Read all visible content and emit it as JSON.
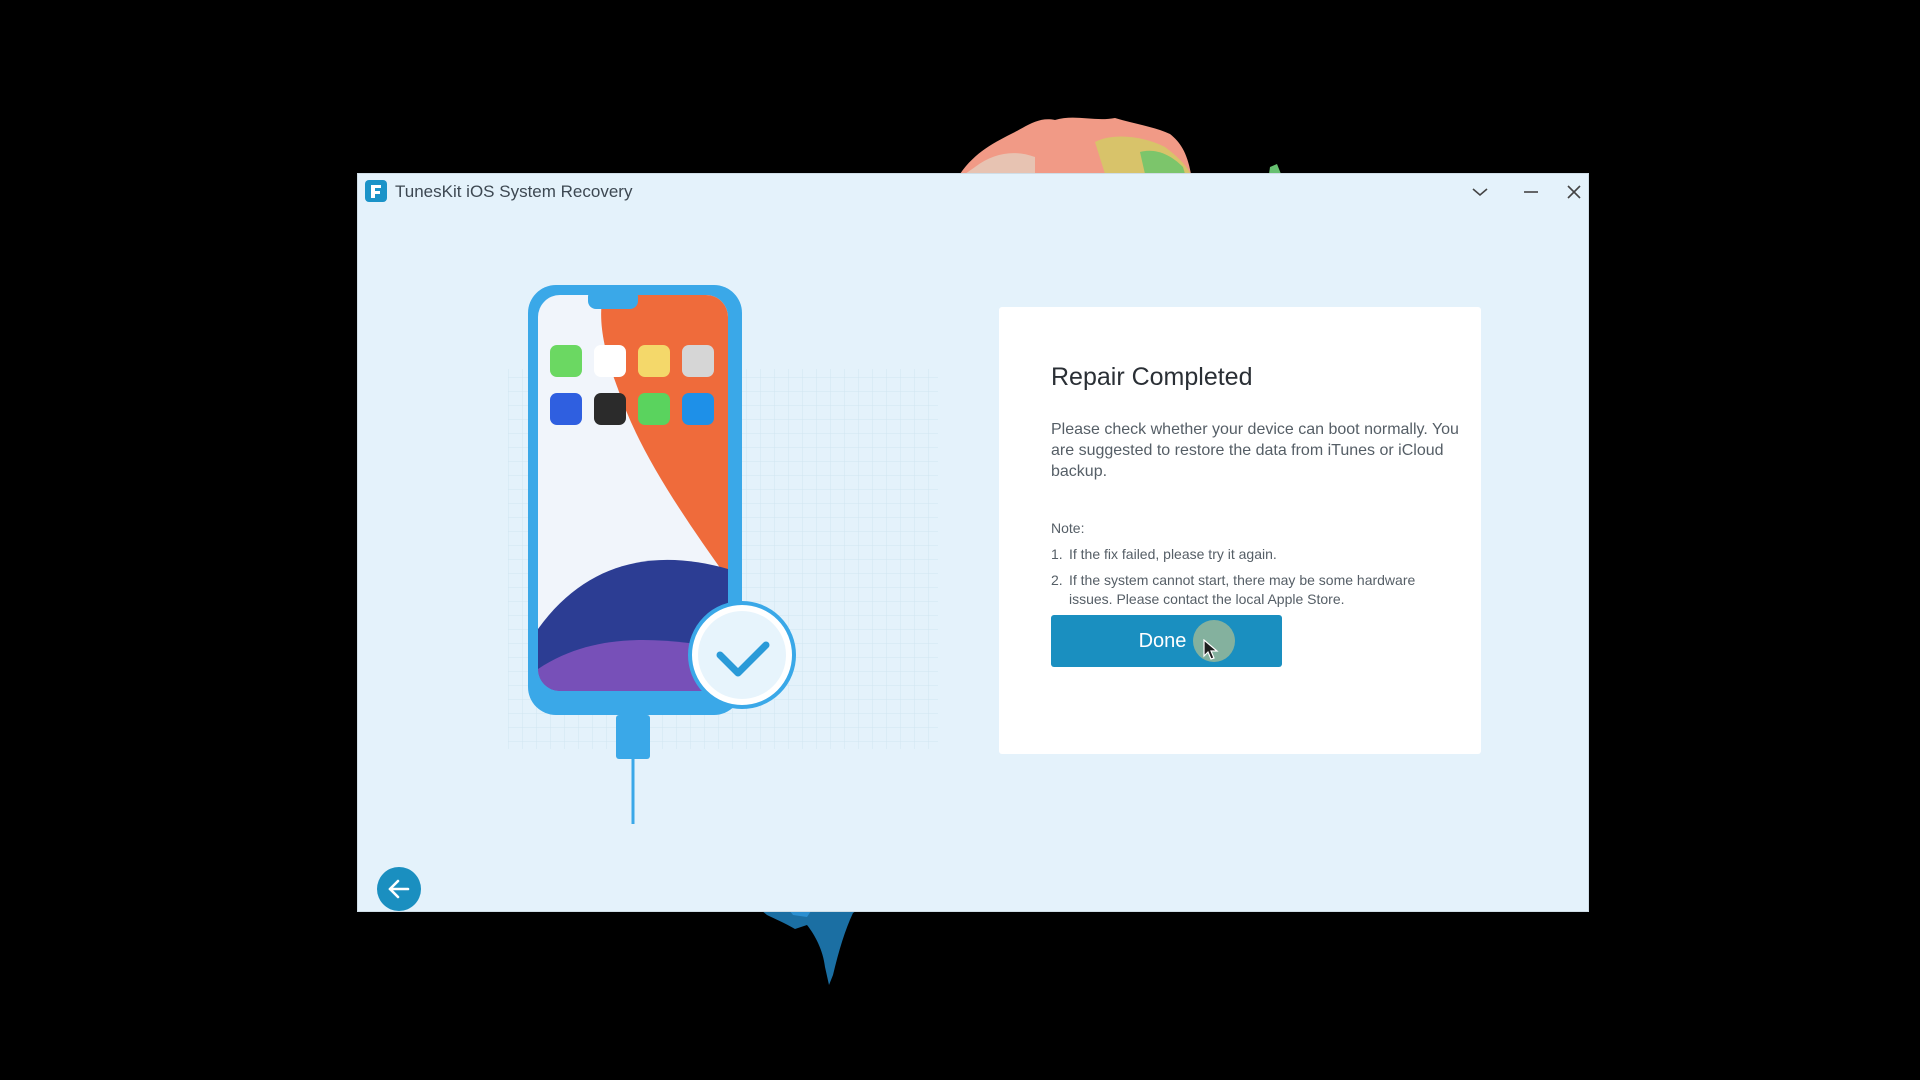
{
  "window": {
    "title": "TunesKit iOS System Recovery"
  },
  "icons": {
    "app_logo": "tuneskit-logo-icon",
    "menu": "chevron-down-icon",
    "minimize": "minimize-icon",
    "close": "close-icon",
    "back": "arrow-left-icon",
    "check": "checkmark-icon"
  },
  "card": {
    "title": "Repair Completed",
    "description": "Please check whether your device can boot normally. You are suggested to restore the data from iTunes or iCloud backup.",
    "note_label": "Note:",
    "notes": [
      {
        "num": "1.",
        "text": "If the fix failed, please try it again."
      },
      {
        "num": "2.",
        "text": "If the system cannot start, there may be some hardware issues. Please contact the local Apple Store."
      }
    ],
    "done_label": "Done"
  },
  "colors": {
    "accent": "#1a8fc0",
    "window_bg": "#e4f2fb",
    "phone_frame": "#3aa8e8"
  }
}
